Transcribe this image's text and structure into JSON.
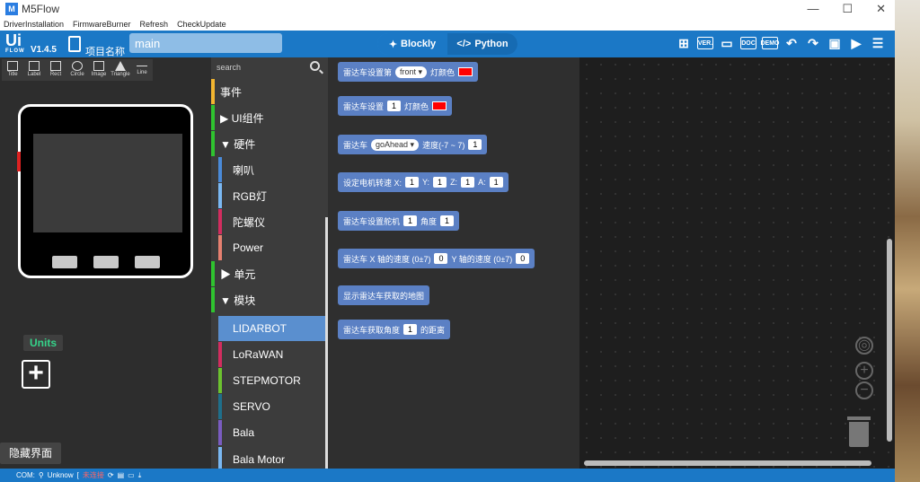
{
  "window": {
    "title": "M5Flow",
    "controls": [
      "—",
      "☐",
      "✕"
    ]
  },
  "menu": [
    "DriverInstallation",
    "FirmwareBurner",
    "Refresh",
    "CheckUpdate"
  ],
  "topbar": {
    "logo_main": "Ui",
    "logo_sub": "FLOW",
    "version": "V1.4.5",
    "project_label": "项目名称",
    "project_name": "main",
    "mode_blockly": "Blockly",
    "mode_python": "Python",
    "icons": [
      "new-file",
      "VER.",
      "comment",
      "DOC",
      "DEMO",
      "undo",
      "redo",
      "download",
      "run",
      "menu"
    ]
  },
  "shape_tools": [
    "Title",
    "Label",
    "Rect",
    "Circle",
    "Image",
    "Triangle",
    "Line"
  ],
  "units": {
    "label": "Units",
    "add": "+"
  },
  "hide_ui_label": "隐藏界面",
  "search": {
    "placeholder": "search"
  },
  "categories": [
    {
      "label": "事件",
      "color": "#f2b530",
      "sub": false
    },
    {
      "label": "▶ UI组件",
      "color": "#2fc32f",
      "sub": false
    },
    {
      "label": "▼ 硬件",
      "color": "#2fc32f",
      "sub": false
    },
    {
      "label": "喇叭",
      "color": "#4a8ad8",
      "sub": true
    },
    {
      "label": "RGB灯",
      "color": "#7ab8f2",
      "sub": true
    },
    {
      "label": "陀螺仪",
      "color": "#d22d5f",
      "sub": true
    },
    {
      "label": "Power",
      "color": "#e68070",
      "sub": true
    },
    {
      "label": "▶ 单元",
      "color": "#2fc32f",
      "sub": false
    },
    {
      "label": "▼ 模块",
      "color": "#2fc32f",
      "sub": false
    },
    {
      "label": "LIDARBOT",
      "color": "#5a8fcf",
      "sub": true,
      "selected": true
    },
    {
      "label": "LoRaWAN",
      "color": "#d22d5f",
      "sub": true
    },
    {
      "label": "STEPMOTOR",
      "color": "#6cc22f",
      "sub": true
    },
    {
      "label": "SERVO",
      "color": "#1f6f8b",
      "sub": true
    },
    {
      "label": "Bala",
      "color": "#7a5cc0",
      "sub": true
    },
    {
      "label": "Bala Motor",
      "color": "#7ab8f2",
      "sub": true
    }
  ],
  "blocks": {
    "b1": {
      "prefix": "雷达车设置第",
      "dropdown": "front ▾",
      "suffix": "灯颜色"
    },
    "b2": {
      "prefix": "雷达车设置",
      "value": "1",
      "suffix": "灯颜色"
    },
    "b3": {
      "prefix": "雷达车",
      "dropdown": "goAhead ▾",
      "middle": "速度(-7 ~ 7)",
      "value": "1"
    },
    "b4": {
      "prefix": "设定电机转速 X:",
      "x": "1",
      "ylabel": "Y:",
      "y": "1",
      "zlabel": "Z:",
      "z": "1",
      "alabel": "A:",
      "a": "1"
    },
    "b5": {
      "prefix": "雷达车设置舵机",
      "value": "1",
      "middle": "角度",
      "value2": "1"
    },
    "b6": {
      "prefix": "雷达车 X 轴的速度 (0±7)",
      "value": "0",
      "middle": "Y 轴的速度 (0±7)",
      "value2": "0"
    },
    "b7": {
      "text": "显示雷达车获取的地图"
    },
    "b8": {
      "prefix": "雷达车获取角度",
      "value": "1",
      "suffix": "的距离"
    }
  },
  "status": {
    "com": "COM:",
    "port": "Unknow",
    "bracket": "[",
    "hidden_state": "未连接"
  }
}
